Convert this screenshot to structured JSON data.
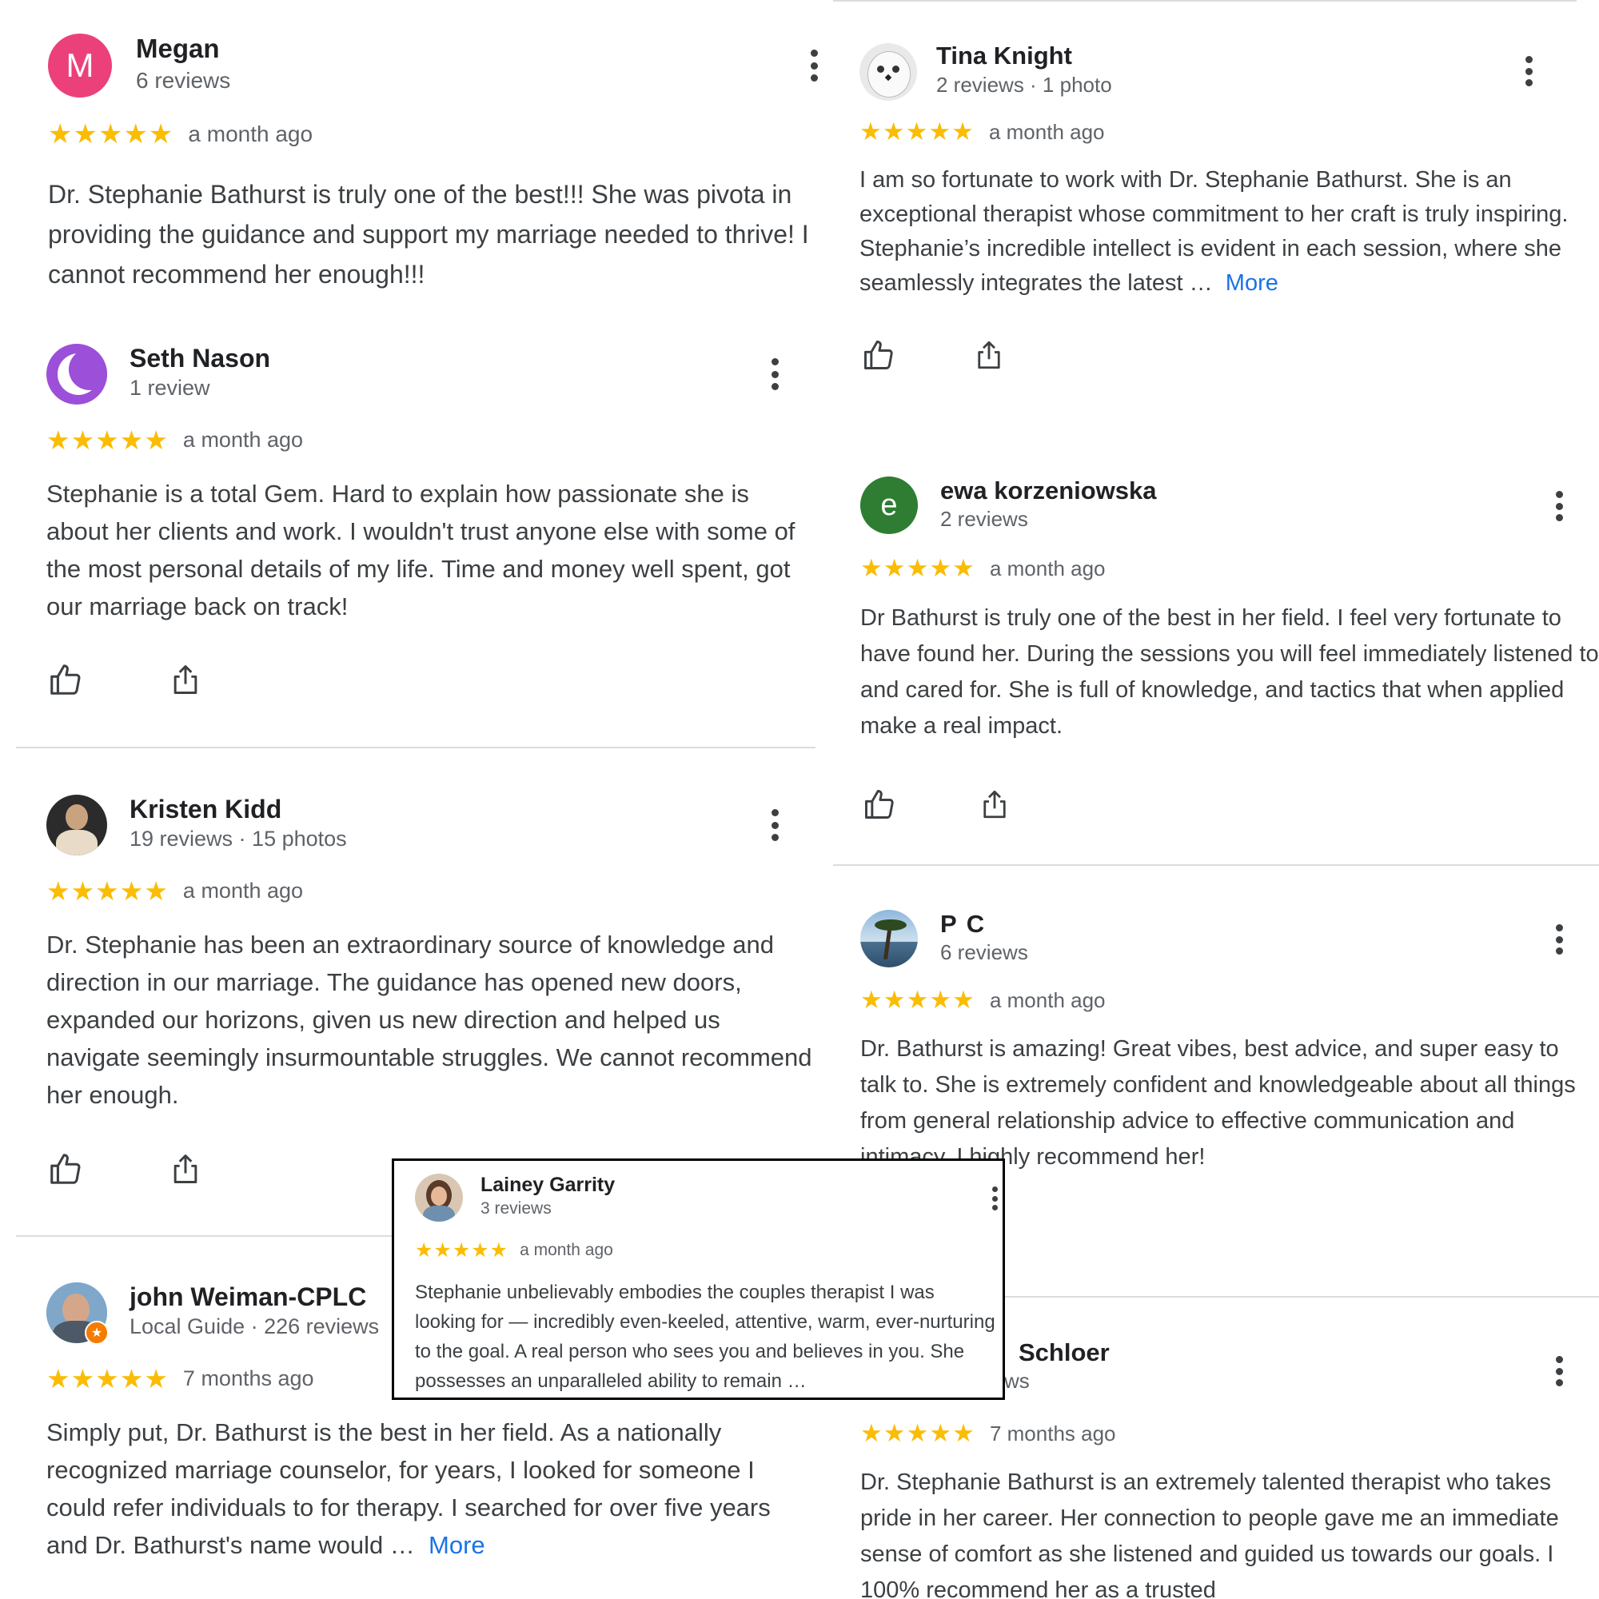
{
  "colors": {
    "star": "#fbbc04",
    "link": "#1a73e8",
    "divider": "#dadce0"
  },
  "reviews": [
    {
      "id": "megan",
      "name": "Megan",
      "meta": "6 reviews",
      "avatar_letter": "M",
      "avatar_color": "#ec407a",
      "stars": "★★★★★",
      "ago": "a month ago",
      "text": "Dr. Stephanie Bathurst is truly one of the best!!! She was pivota in providing the guidance and support my marriage needed to thrive! I cannot recommend her enough!!!"
    },
    {
      "id": "seth",
      "name": "Seth Nason",
      "meta": "1 review",
      "avatar_icon": "crescent-moon-icon",
      "stars": "★★★★★",
      "ago": "a month ago",
      "text": "Stephanie is a total Gem. Hard to explain how passionate she is about her clients and work. I wouldn't trust anyone else with some of the most personal details of my life. Time and money well spent, got our marriage back on track!"
    },
    {
      "id": "kristen",
      "name": "Kristen Kidd",
      "meta": "19 reviews · 15 photos",
      "avatar_icon": "profile-photo",
      "stars": "★★★★★",
      "ago": "a month ago",
      "text": "Dr. Stephanie has been an extraordinary source of knowledge and direction in our marriage. The guidance has opened new doors, expanded our horizons, given us new direction and helped us navigate seemingly insurmountable struggles. We cannot recommend her enough."
    },
    {
      "id": "john",
      "name": "john Weiman-CPLC",
      "meta": "Local Guide · 226 reviews",
      "avatar_icon": "profile-photo",
      "stars": "★★★★★",
      "ago": "7 months ago",
      "text": "Simply put, Dr. Bathurst is the best in her field. As a nationally recognized marriage counselor, for years, I looked for someone I could refer individuals to for therapy. I searched for over five years and Dr. Bathurst's name would …",
      "more": "More"
    },
    {
      "id": "tina",
      "name": "Tina Knight",
      "meta": "2 reviews · 1 photo",
      "avatar_icon": "owl-photo",
      "stars": "★★★★★",
      "ago": "a month ago",
      "text": "I am so fortunate to work with Dr. Stephanie Bathurst. She is an exceptional therapist whose commitment to her craft is truly inspiring. Stephanie’s incredible intellect is evident in each session, where she seamlessly integrates the latest …",
      "more": "More"
    },
    {
      "id": "ewa",
      "name": "ewa korzeniowska",
      "meta": "2 reviews",
      "avatar_letter": "e",
      "avatar_color": "#2e7d32",
      "stars": "★★★★★",
      "ago": "a month ago",
      "text": "Dr Bathurst is truly one of the best in her field. I feel very fortunate to have found her. During the sessions you will feel immediately listened to and cared for. She is full of knowledge, and tactics that when applied make a real impact."
    },
    {
      "id": "pc",
      "name": "P C",
      "meta": "6 reviews",
      "avatar_icon": "palm-tree-photo",
      "stars": "★★★★★",
      "ago": "a month ago",
      "text": "Dr. Bathurst is amazing! Great vibes, best advice, and super easy to talk to. She is extremely confident and knowledgeable about all things from general relationship advice to effective communication and intimacy. I highly recommend her!"
    },
    {
      "id": "schloer",
      "name": "Schloer",
      "meta": "ws",
      "stars": "★★★★★",
      "ago": "7 months ago",
      "text": "Dr. Stephanie Bathurst is an extremely talented therapist who takes pride in her career. Her connection to people gave me an immediate sense of comfort as she listened and guided us towards our goals. I 100% recommend her as a trusted"
    }
  ],
  "popup": {
    "name": "Lainey Garrity",
    "meta": "3 reviews",
    "avatar_icon": "profile-photo",
    "stars": "★★★★★",
    "ago": "a month ago",
    "text": "Stephanie unbelievably embodies the couples therapist I was looking for — incredibly even-keeled, attentive, warm, ever-nurturing to the goal. A real person who sees you and believes in you. She possesses an unparalleled ability to remain …"
  }
}
